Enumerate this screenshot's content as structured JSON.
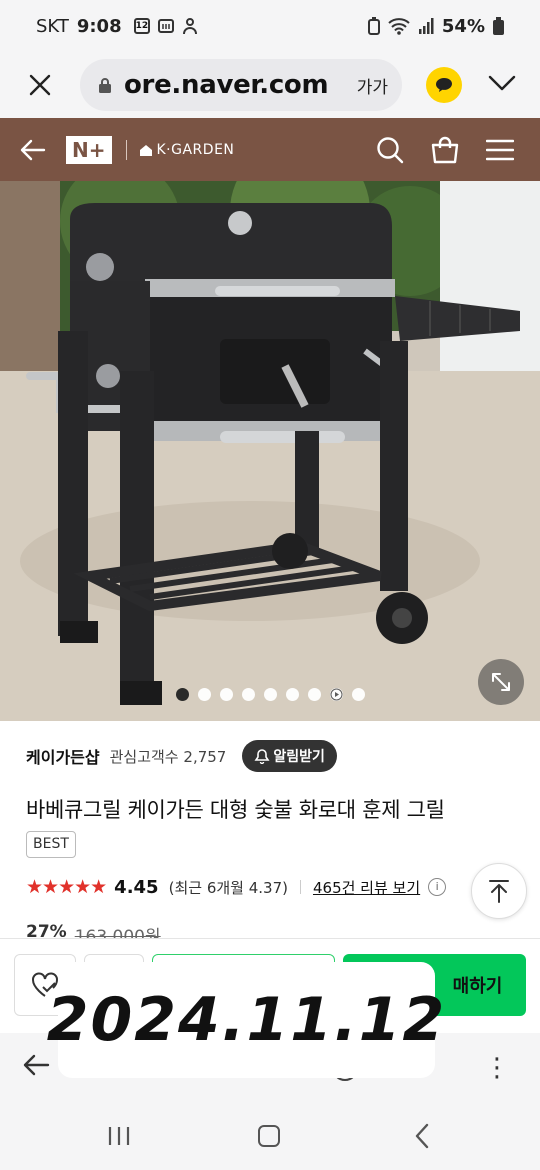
{
  "status_bar": {
    "carrier": "SKT",
    "time": "9:08",
    "calendar_badge": "12",
    "battery": "54%"
  },
  "browser": {
    "url": "ore.naver.com",
    "text_size_label": "가가"
  },
  "site_header": {
    "logo": "N+",
    "brand": "K·GARDEN"
  },
  "gallery": {
    "image_count": 9,
    "active_index": 0,
    "video_index": 7
  },
  "product": {
    "store_name": "케이가든샵",
    "followers_label": "관심고객수",
    "followers": "2,757",
    "alarm_button": "알림받기",
    "title": "바베큐그릴 케이가든 대형 숯불 화로대 훈제 그릴",
    "badge": "BEST",
    "stars_value": 4.45,
    "rating": "4.45",
    "recent_rating": "(최근 6개월 4.37)",
    "review_link": "465건 리뷰 보기",
    "info_icon": "i",
    "discount": "27%",
    "original_price": "163,000원"
  },
  "buy_bar": {
    "buy_label": "매하기"
  },
  "date_stamp": "2024.11.12",
  "colors": {
    "header_brown": "#7a5444",
    "naver_green": "#03c75a",
    "star_red": "#e1322b",
    "kakao_yellow": "#ffd400"
  }
}
